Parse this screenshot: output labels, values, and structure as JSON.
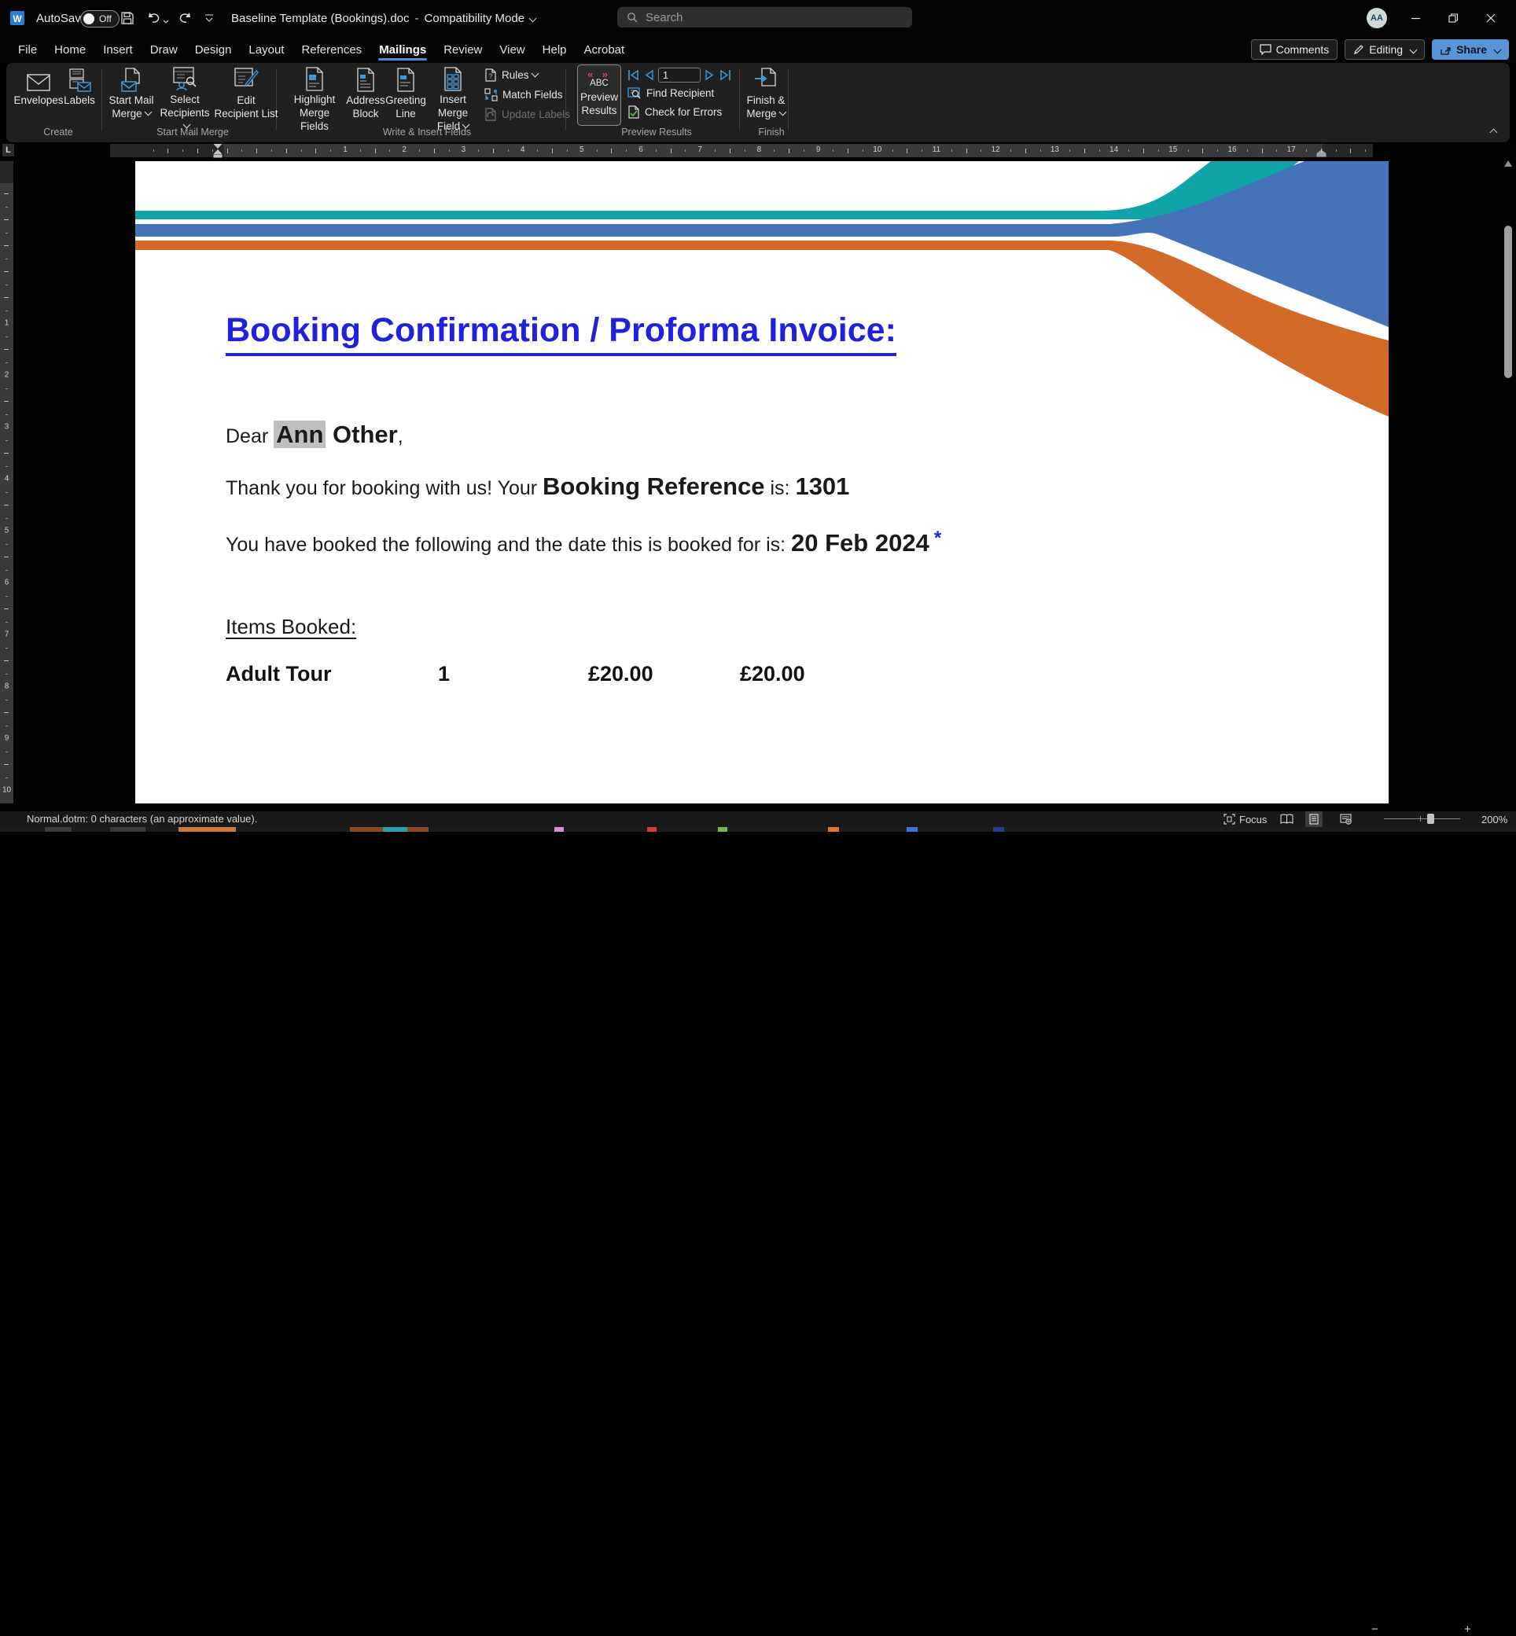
{
  "titlebar": {
    "autosave_label": "AutoSave",
    "autosave_state": "Off",
    "doc_title": "Baseline Template (Bookings).doc",
    "title_separator": "-",
    "doc_mode": "Compatibility Mode",
    "search_placeholder": "Search",
    "avatar_initials": "AA"
  },
  "tabs": {
    "items": [
      {
        "label": "File"
      },
      {
        "label": "Home"
      },
      {
        "label": "Insert"
      },
      {
        "label": "Draw"
      },
      {
        "label": "Design"
      },
      {
        "label": "Layout"
      },
      {
        "label": "References"
      },
      {
        "label": "Mailings"
      },
      {
        "label": "Review"
      },
      {
        "label": "View"
      },
      {
        "label": "Help"
      },
      {
        "label": "Acrobat"
      }
    ],
    "comments": "Comments",
    "editing": "Editing",
    "share": "Share"
  },
  "ribbon": {
    "create": {
      "group_label": "Create",
      "envelopes": "Envelopes",
      "labels": "Labels"
    },
    "start": {
      "group_label": "Start Mail Merge",
      "start1": "Start Mail",
      "start2": "Merge",
      "select1": "Select",
      "select2": "Recipients",
      "edit1": "Edit",
      "edit2": "Recipient List"
    },
    "write": {
      "group_label": "Write & Insert Fields",
      "highlight1": "Highlight",
      "highlight2": "Merge Fields",
      "address1": "Address",
      "address2": "Block",
      "greeting1": "Greeting",
      "greeting2": "Line",
      "insert1": "Insert Merge",
      "insert2": "Field",
      "rules": "Rules",
      "match": "Match Fields",
      "update": "Update Labels"
    },
    "preview": {
      "group_label": "Preview Results",
      "preview1": "Preview",
      "preview2": "Results",
      "abc": "ABC",
      "marks": "« »",
      "record": "1",
      "find": "Find Recipient",
      "check": "Check for Errors"
    },
    "finish": {
      "group_label": "Finish",
      "finish1": "Finish &",
      "finish2": "Merge"
    }
  },
  "ruler": {
    "tab_selector": "L",
    "h_numbers": [
      1,
      2,
      3,
      4,
      5,
      6,
      7,
      8,
      9,
      10,
      11,
      12,
      13,
      14,
      15,
      16,
      17
    ],
    "v_numbers": [
      1,
      2,
      3,
      4,
      5,
      6,
      7,
      8,
      9,
      10
    ]
  },
  "document": {
    "title": "Booking Confirmation / Proforma Invoice:",
    "greeting_prefix": "Dear ",
    "recipient_first": "Ann",
    "recipient_rest": " Other",
    "greeting_suffix": ",",
    "line2_prefix": "Thank you for booking with us! Your ",
    "line2_bold": "Booking Reference",
    "line2_mid": " is: ",
    "line2_ref": "1301",
    "line3_prefix": "You have booked the following and the date this is booked for is: ",
    "line3_date": "20 Feb 2024",
    "line3_asterisk": "*",
    "items_heading": "Items Booked:",
    "item": {
      "name": "Adult Tour",
      "qty": "1",
      "unit_price": "£20.00",
      "total": "£20.00"
    }
  },
  "statusbar": {
    "left_text": "Normal.dotm: 0 characters (an approximate value).",
    "focus": "Focus",
    "zoom": "200%"
  },
  "colors": {
    "accent_blue": "#4a8fd6",
    "title_blue": "#2121dc",
    "swoosh_teal": "#10a4a8",
    "swoosh_blue": "#4573b8",
    "swoosh_orange": "#d26b28",
    "icon_blue": "#3f9bdc",
    "check_green": "#55b04f",
    "marks_red": "#c75050"
  }
}
